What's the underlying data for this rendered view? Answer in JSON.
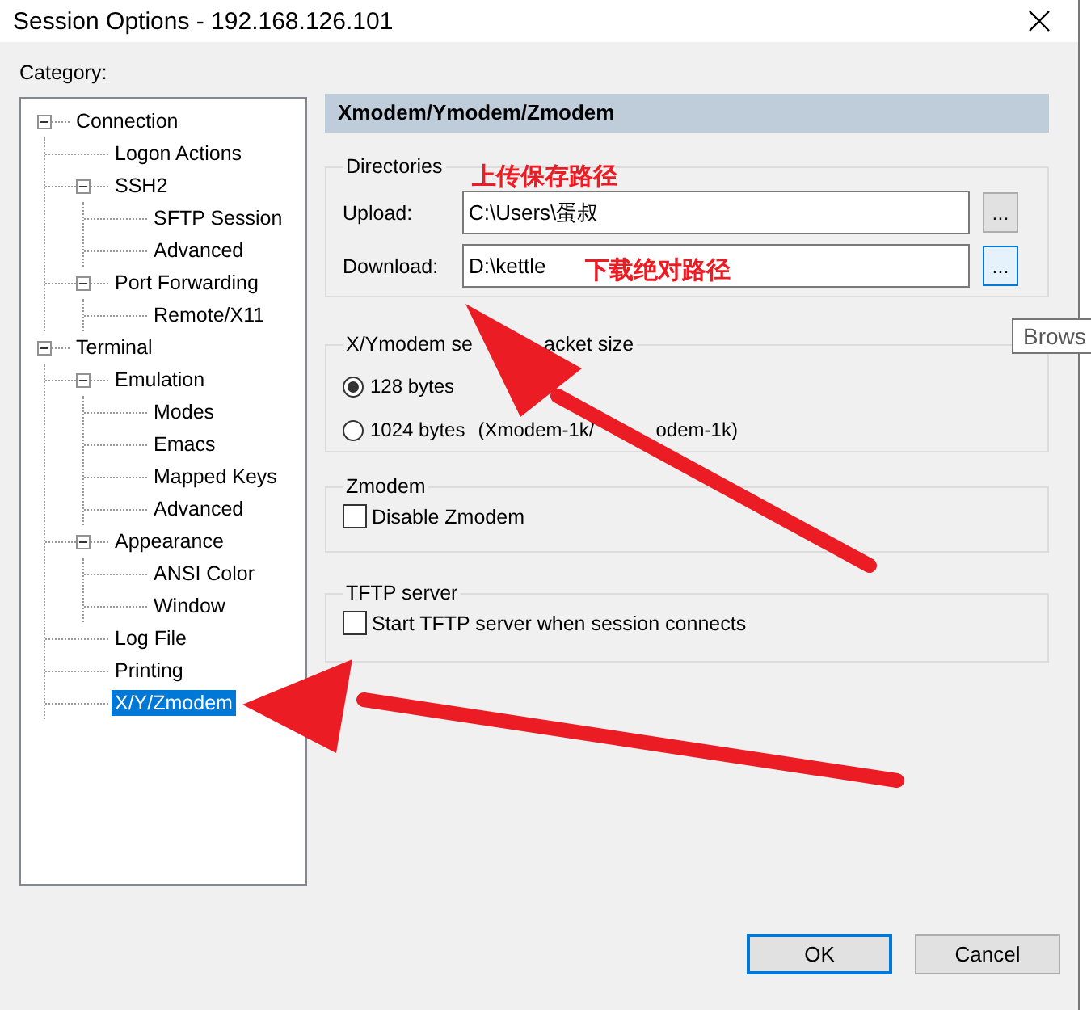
{
  "window": {
    "title": "Session Options - 192.168.126.101"
  },
  "category_label": "Category:",
  "tree": [
    {
      "label": "Connection",
      "expanded": true,
      "selected": false,
      "children": [
        {
          "label": "Logon Actions",
          "selected": false
        },
        {
          "label": "SSH2",
          "expanded": true,
          "selected": false,
          "children": [
            {
              "label": "SFTP Session",
              "selected": false
            },
            {
              "label": "Advanced",
              "selected": false
            }
          ]
        },
        {
          "label": "Port Forwarding",
          "expanded": true,
          "selected": false,
          "children": [
            {
              "label": "Remote/X11",
              "selected": false
            }
          ]
        }
      ]
    },
    {
      "label": "Terminal",
      "expanded": true,
      "selected": false,
      "children": [
        {
          "label": "Emulation",
          "expanded": true,
          "selected": false,
          "children": [
            {
              "label": "Modes",
              "selected": false
            },
            {
              "label": "Emacs",
              "selected": false
            },
            {
              "label": "Mapped Keys",
              "selected": false
            },
            {
              "label": "Advanced",
              "selected": false
            }
          ]
        },
        {
          "label": "Appearance",
          "expanded": true,
          "selected": false,
          "children": [
            {
              "label": "ANSI Color",
              "selected": false
            },
            {
              "label": "Window",
              "selected": false
            }
          ]
        },
        {
          "label": "Log File",
          "selected": false
        },
        {
          "label": "Printing",
          "selected": false
        },
        {
          "label": "X/Y/Zmodem",
          "selected": true
        }
      ]
    }
  ],
  "panel_header": "Xmodem/Ymodem/Zmodem",
  "directories": {
    "title": "Directories",
    "fields": [
      {
        "label": "Upload:",
        "value": "C:\\Users\\蛋叔",
        "button": "...",
        "hovered": false
      },
      {
        "label": "Download:",
        "value": "D:\\kettle",
        "button": "...",
        "hovered": true
      }
    ]
  },
  "packet_size": {
    "title_parts": [
      "X/Ymodem se",
      "acket size"
    ],
    "options": [
      {
        "label": "128 bytes",
        "selected": true
      },
      {
        "label": "1024 bytes",
        "note_parts": [
          "(Xmodem-1k/",
          "odem-1k)"
        ],
        "selected": false
      }
    ]
  },
  "zmodem": {
    "title": "Zmodem",
    "checkbox": {
      "label": "Disable Zmodem",
      "checked": false
    }
  },
  "tftp": {
    "title": "TFTP server",
    "checkbox": {
      "label": "Start TFTP server when session connects",
      "checked": false
    }
  },
  "tooltip": {
    "text": "Brows"
  },
  "annotations": [
    {
      "text": "上传保存路径"
    },
    {
      "text": "下载绝对路径"
    }
  ],
  "buttons": [
    {
      "label": "OK",
      "default": true
    },
    {
      "label": "Cancel",
      "default": false
    }
  ]
}
